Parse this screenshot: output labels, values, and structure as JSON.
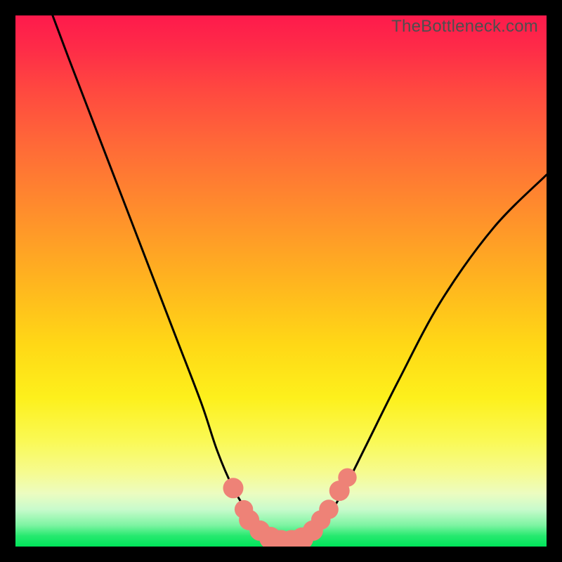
{
  "watermark": "TheBottleneck.com",
  "chart_data": {
    "type": "line",
    "title": "",
    "xlabel": "",
    "ylabel": "",
    "ylim": [
      0,
      100
    ],
    "xlim": [
      0,
      100
    ],
    "series": [
      {
        "name": "bottleneck-curve",
        "x": [
          7,
          10,
          15,
          20,
          25,
          30,
          35,
          38,
          41,
          44,
          46,
          48,
          50,
          52,
          54,
          56,
          59,
          62,
          66,
          72,
          80,
          90,
          100
        ],
        "y": [
          100,
          92,
          79,
          66,
          53,
          40,
          27,
          18,
          11,
          6,
          3,
          1.5,
          1,
          1,
          1.5,
          3,
          6,
          11,
          19,
          31,
          46,
          60,
          70
        ]
      }
    ],
    "markers": {
      "name": "highlight-dots",
      "color": "#ee8277",
      "points": [
        {
          "x": 41,
          "y": 11,
          "r": 1.4
        },
        {
          "x": 43,
          "y": 7,
          "r": 1.2
        },
        {
          "x": 44,
          "y": 5,
          "r": 1.4
        },
        {
          "x": 46,
          "y": 3,
          "r": 1.4
        },
        {
          "x": 48,
          "y": 1.6,
          "r": 1.6
        },
        {
          "x": 50,
          "y": 1,
          "r": 1.6
        },
        {
          "x": 52,
          "y": 1,
          "r": 1.6
        },
        {
          "x": 54,
          "y": 1.5,
          "r": 1.6
        },
        {
          "x": 56,
          "y": 3,
          "r": 1.4
        },
        {
          "x": 57.5,
          "y": 5,
          "r": 1.3
        },
        {
          "x": 59,
          "y": 7,
          "r": 1.3
        },
        {
          "x": 61,
          "y": 10.5,
          "r": 1.4
        },
        {
          "x": 62.5,
          "y": 13,
          "r": 1.2
        }
      ]
    },
    "colors": {
      "curve": "#000000",
      "markers": "#ee8277",
      "gradient_top": "#fe1a4c",
      "gradient_mid": "#ffd816",
      "gradient_bottom": "#00e45a"
    }
  }
}
